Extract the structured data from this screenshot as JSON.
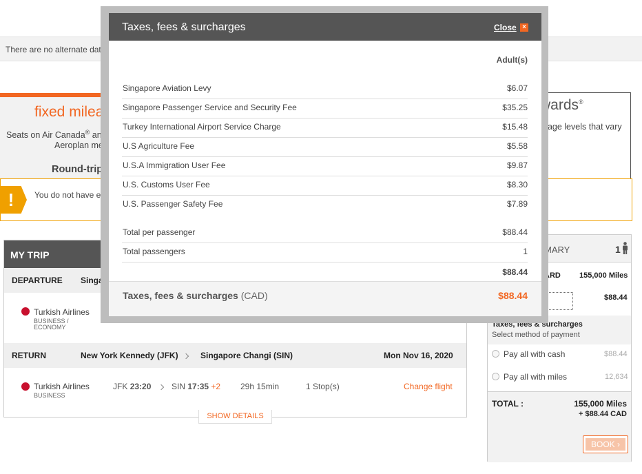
{
  "alternate_notice": "There are no alternate dates",
  "fixed_panel": {
    "title": "fixed milea",
    "line1": "Seats on Air Canada",
    "line1_sup": "®",
    "line1_tail": " and",
    "line2": "Aeroplan mer",
    "round_trip": "Round-trip"
  },
  "flex_panel": {
    "title": "wards",
    "title_sup": "®",
    "line": "eage levels that vary"
  },
  "warning": {
    "icon": "!",
    "text": "You do not have eno"
  },
  "my_trip": {
    "title": "MY TRIP",
    "departure": {
      "label": "DEPARTURE",
      "from_partial": "Singap",
      "airline": "Turkish Airlines",
      "class_line1": "BUSINESS /",
      "class_line2": "ECONOMY"
    },
    "return": {
      "label": "RETURN",
      "from": "New York Kennedy (JFK)",
      "to": "Singapore Changi (SIN)",
      "date": "Mon Nov 16, 2020",
      "airline": "Turkish Airlines",
      "class": "BUSINESS",
      "dep_code": "JFK",
      "dep_time": "23:20",
      "arr_code": "SIN",
      "arr_time": "17:35",
      "day_offset": "+2",
      "duration": "29h 15min",
      "stops": "1 Stop(s)",
      "change_label": "Change flight"
    },
    "show_details": "SHOW DETAILS"
  },
  "summary": {
    "title_partial": "MARY",
    "passengers": "1",
    "award_label_partial": "ARD",
    "award_miles": "155,000 Miles",
    "taxes_amount": "$88.44",
    "taxes_title": "Taxes, fees & surcharges",
    "taxes_sub": "Select method of payment",
    "pay_cash_label": "Pay all with cash",
    "pay_cash_value": "$88.44",
    "pay_miles_label": "Pay all with miles",
    "pay_miles_value": "12,634",
    "total_label": "TOTAL :",
    "total_miles": "155,000  Miles",
    "total_cash": "+ $88.44  CAD",
    "book_label": "BOOK ›"
  },
  "modal": {
    "title": "Taxes, fees & surcharges",
    "close_label": "Close",
    "close_icon": "×",
    "column_header": "Adult(s)",
    "fees": [
      {
        "name": "Singapore Aviation Levy",
        "amount": "$6.07"
      },
      {
        "name": "Singapore Passenger Service and Security Fee",
        "amount": "$35.25"
      },
      {
        "name": "Turkey International Airport Service Charge",
        "amount": "$15.48"
      },
      {
        "name": "U.S Agriculture Fee",
        "amount": "$5.58"
      },
      {
        "name": "U.S.A Immigration User Fee",
        "amount": "$9.87"
      },
      {
        "name": "U.S. Customs User Fee",
        "amount": "$8.30"
      },
      {
        "name": "U.S. Passenger Safety Fee",
        "amount": "$7.89"
      }
    ],
    "total_per_passenger_label": "Total per passenger",
    "total_per_passenger": "$88.44",
    "total_passengers_label": "Total passengers",
    "total_passengers": "1",
    "grand_total": "$88.44",
    "footer_label": "Taxes, fees & surcharges",
    "footer_currency": "(CAD)",
    "footer_amount": "$88.44"
  }
}
